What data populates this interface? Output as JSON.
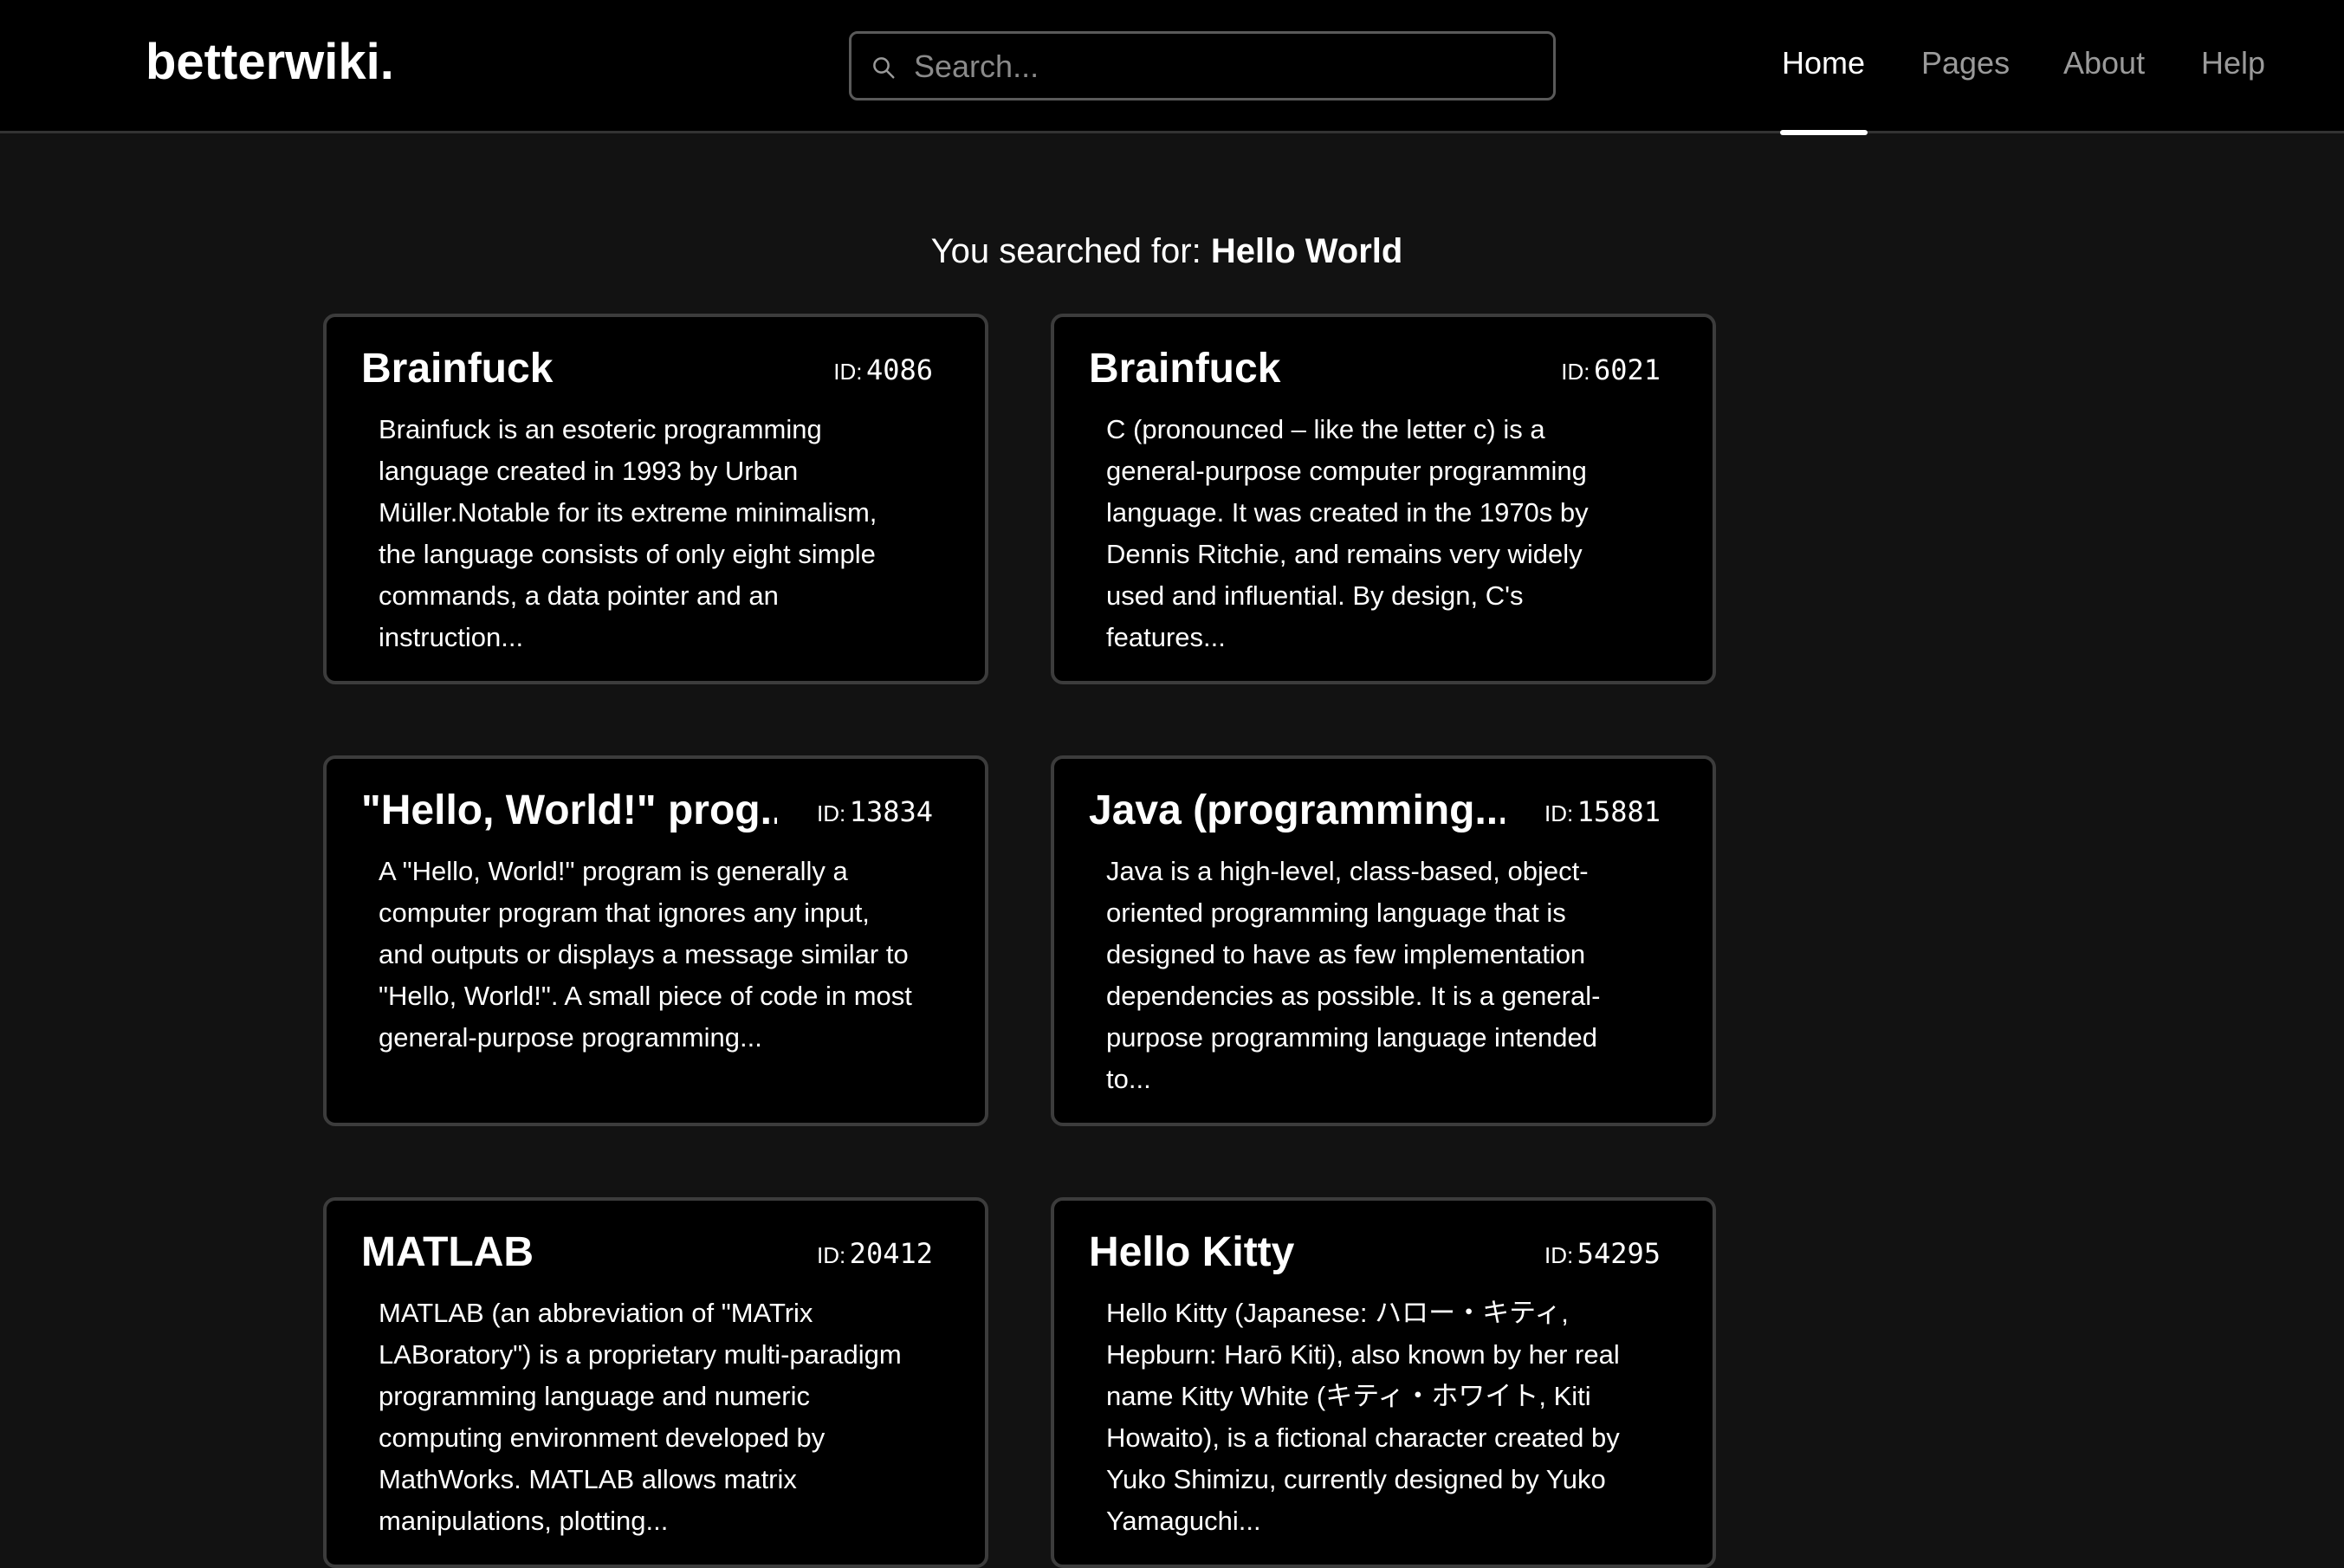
{
  "brand": "betterwiki.",
  "search": {
    "placeholder": "Search...",
    "value": ""
  },
  "nav": [
    "Home",
    "Pages",
    "About",
    "Help"
  ],
  "active_nav": "Home",
  "results_prefix": "You searched for:",
  "query": "Hello World",
  "id_label": "ID:",
  "results": [
    {
      "title": "Brainfuck",
      "id": "4086",
      "snippet": "Brainfuck is an esoteric programming language created in 1993 by Urban Müller.Notable for its extreme minimalism, the language consists of only eight simple commands, a data pointer and an instruction..."
    },
    {
      "title": "Brainfuck",
      "id": "6021",
      "snippet": "C (pronounced – like the letter c) is a general-purpose computer programming language. It was created in the 1970s by Dennis Ritchie, and remains very widely used and influential. By design, C's features..."
    },
    {
      "title": "\"Hello, World!\" prog...",
      "id": "13834",
      "snippet": "A \"Hello, World!\" program is generally a computer program that ignores any input, and outputs or displays a message similar to \"Hello, World!\". A small piece of code in most general-purpose programming..."
    },
    {
      "title": "Java (programming...",
      "id": "15881",
      "snippet": "Java is a high-level, class-based, object-oriented programming language that is designed to have as few implementation dependencies as possible. It is a general-purpose programming language intended to..."
    },
    {
      "title": "MATLAB",
      "id": "20412",
      "snippet": "MATLAB (an abbreviation of \"MATrix LABoratory\") is a proprietary multi-paradigm programming language and numeric computing environment developed by MathWorks. MATLAB allows matrix manipulations, plotting..."
    },
    {
      "title": "Hello Kitty",
      "id": "54295",
      "snippet": "Hello Kitty (Japanese: ハロー・キティ, Hepburn: Harō Kiti), also known by her real name Kitty White (キティ・ホワイト, Kiti Howaito), is a fictional character created by Yuko Shimizu, currently designed by Yuko Yamaguchi..."
    }
  ]
}
